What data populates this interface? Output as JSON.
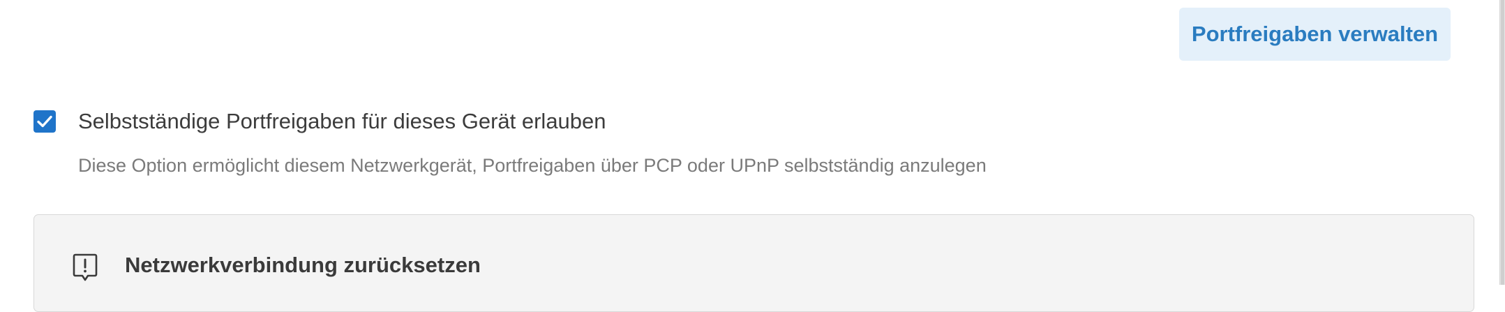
{
  "actions": {
    "manage_port_forwards_label": "Portfreigaben verwalten"
  },
  "option": {
    "checked": true,
    "label": "Selbstständige Portfreigaben für dieses Gerät erlauben",
    "description": "Diese Option ermöglicht diesem Netzwerkgerät, Portfreigaben über PCP oder UPnP selbstständig anzulegen"
  },
  "panel": {
    "icon": "alert-message-icon",
    "title": "Netzwerkverbindung zurücksetzen"
  },
  "colors": {
    "accent": "#1f74c9",
    "button_bg": "#e4f0fa",
    "button_text": "#2a7cc0",
    "panel_bg": "#f4f4f4"
  }
}
